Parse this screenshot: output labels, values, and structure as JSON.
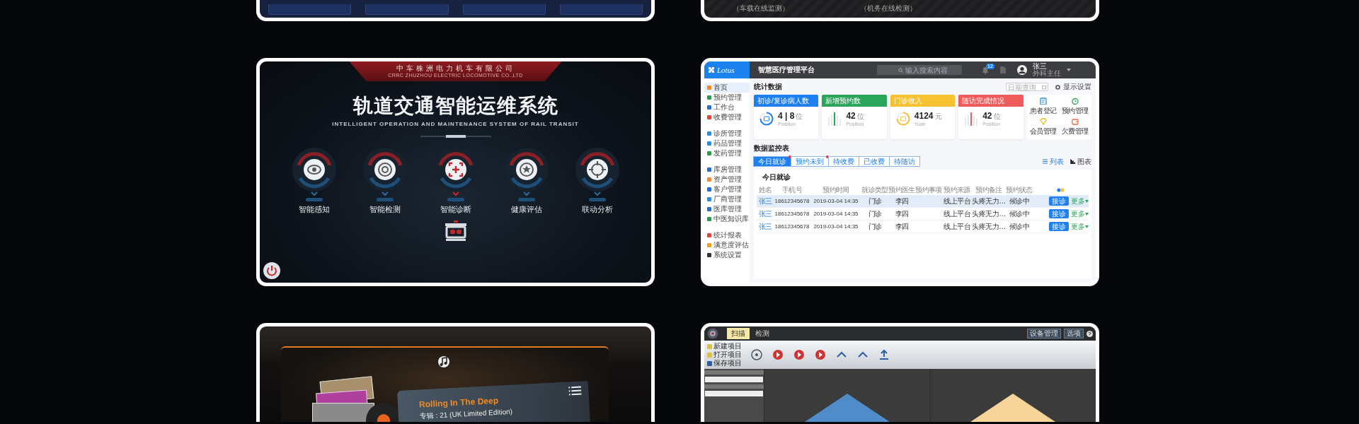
{
  "top_row": {
    "right_card": {
      "captions": [
        "（车载在线监测）",
        "（机务在线检测）"
      ]
    }
  },
  "rail_card": {
    "company": "中车株洲电力机车有限公司",
    "company_en": "CRRC ZHUZHOU ELECTRIC LOCOMOTIVE CO.,LTD",
    "title": "轨道交通智能运维系统",
    "subtitle": "INTELLIGENT OPERATION AND MAINTENANCE SYSTEM OF RAIL TRANSIT",
    "modules": [
      {
        "label": "智能感知",
        "selected": false
      },
      {
        "label": "智能检测",
        "selected": false
      },
      {
        "label": "智能诊断",
        "selected": true
      },
      {
        "label": "健康评估",
        "selected": false
      },
      {
        "label": "联动分析",
        "selected": false
      }
    ]
  },
  "medical_card": {
    "logo": "Lotus",
    "title": "智慧医疗管理平台",
    "search": {
      "placeholder": "输入搜索内容"
    },
    "notification_count": "12",
    "user": {
      "name": "张三",
      "role": "外科主任"
    },
    "sidebar": {
      "groups": [
        [
          {
            "label": "首页",
            "selected": true,
            "color": "#f08c2c"
          },
          {
            "label": "预约管理",
            "selected": false,
            "color": "#2e9a4e"
          },
          {
            "label": "工作台",
            "selected": false,
            "color": "#1f6fd6"
          },
          {
            "label": "收费管理",
            "selected": false,
            "color": "#e0463c"
          }
        ],
        [
          {
            "label": "诊所管理",
            "selected": false,
            "color": "#2a8fe0"
          },
          {
            "label": "药品管理",
            "selected": false,
            "color": "#2a8fe0"
          },
          {
            "label": "发药管理",
            "selected": false,
            "color": "#2e9a4e"
          }
        ],
        [
          {
            "label": "库房管理",
            "selected": false,
            "color": "#1f6fd6"
          },
          {
            "label": "资产管理",
            "selected": false,
            "color": "#f08c2c"
          },
          {
            "label": "客户管理",
            "selected": false,
            "color": "#1f6fd6"
          },
          {
            "label": "厂商管理",
            "selected": false,
            "color": "#2a8fe0"
          },
          {
            "label": "医库管理",
            "selected": false,
            "color": "#1f6fd6"
          },
          {
            "label": "中医知识库",
            "selected": false,
            "color": "#2e9a4e"
          }
        ],
        [
          {
            "label": "统计报表",
            "selected": false,
            "color": "#e0463c"
          },
          {
            "label": "满意度评估",
            "selected": false,
            "color": "#f0a020"
          },
          {
            "label": "系统设置",
            "selected": false,
            "color": "#333333"
          }
        ]
      ]
    },
    "stats_heading": "统计数据",
    "date_filter": {
      "placeholder": "日期查询"
    },
    "display_settings": "显示设置",
    "stats": [
      {
        "title": "初诊/复诊病人数",
        "color": "#1e7ff0",
        "kind": "ring",
        "value": "4 | 8",
        "unit": "位",
        "caption": "Position"
      },
      {
        "title": "新增预约数",
        "color": "#2aa55a",
        "kind": "bars",
        "value": "42",
        "unit": "位",
        "caption": "Position"
      },
      {
        "title": "门诊收入",
        "color": "#f7c232",
        "kind": "ring",
        "value": "4124",
        "unit": "元",
        "caption": "Yuan"
      },
      {
        "title": "随访完成情况",
        "color": "#ef5b5b",
        "kind": "bars",
        "value": "42",
        "unit": "位",
        "caption": "Position"
      }
    ],
    "quick_links": [
      "患者登记",
      "预约管理",
      "会员管理",
      "欠费管理"
    ],
    "monitor_heading": "数据监控表",
    "tabs": [
      {
        "label": "今日就诊",
        "selected": true,
        "badge": true
      },
      {
        "label": "预约未到",
        "selected": false,
        "badge": true
      },
      {
        "label": "待收费",
        "selected": false,
        "badge": false
      },
      {
        "label": "已收费",
        "selected": false,
        "badge": false
      },
      {
        "label": "待随访",
        "selected": false,
        "badge": false
      }
    ],
    "view_toggles": [
      "列表",
      "图表"
    ],
    "table": {
      "title": "今日就诊",
      "columns": [
        "姓名",
        "手机号",
        "预约时间",
        "就诊类型",
        "预约医生",
        "预约事项",
        "预约来源",
        "预约备注",
        "预约状态"
      ],
      "rows": [
        {
          "selected": true,
          "cells": [
            "张三",
            "18612345678",
            "2019-03-04 14:35",
            "门诊",
            "李四",
            null,
            "线上平台",
            "头疼无力…",
            "候诊中"
          ],
          "action": "接诊",
          "more": "更多"
        },
        {
          "selected": false,
          "cells": [
            "张三",
            "18612345678",
            "2019-03-04 14:35",
            "门诊",
            "李四",
            null,
            "线上平台",
            "头疼无力…",
            "候诊中"
          ],
          "action": "接诊",
          "more": "更多"
        },
        {
          "selected": false,
          "cells": [
            "张三",
            "18612345678",
            "2019-03-04 14:35",
            "门诊",
            "李四",
            null,
            "线上平台",
            "头疼无力…",
            "候诊中"
          ],
          "action": "接诊",
          "more": "更多"
        }
      ]
    }
  },
  "music_card": {
    "track": "Rolling In The Deep",
    "album": "专辑 : 21 (UK Limited Edition)"
  },
  "scan_app_card": {
    "tabs": [
      {
        "label": "扫描",
        "selected": true
      },
      {
        "label": "检测",
        "selected": false
      }
    ],
    "window_buttons": [
      "设备管理",
      "选项"
    ],
    "project_actions": [
      "新建项目",
      "打开项目",
      "保存项目"
    ]
  }
}
